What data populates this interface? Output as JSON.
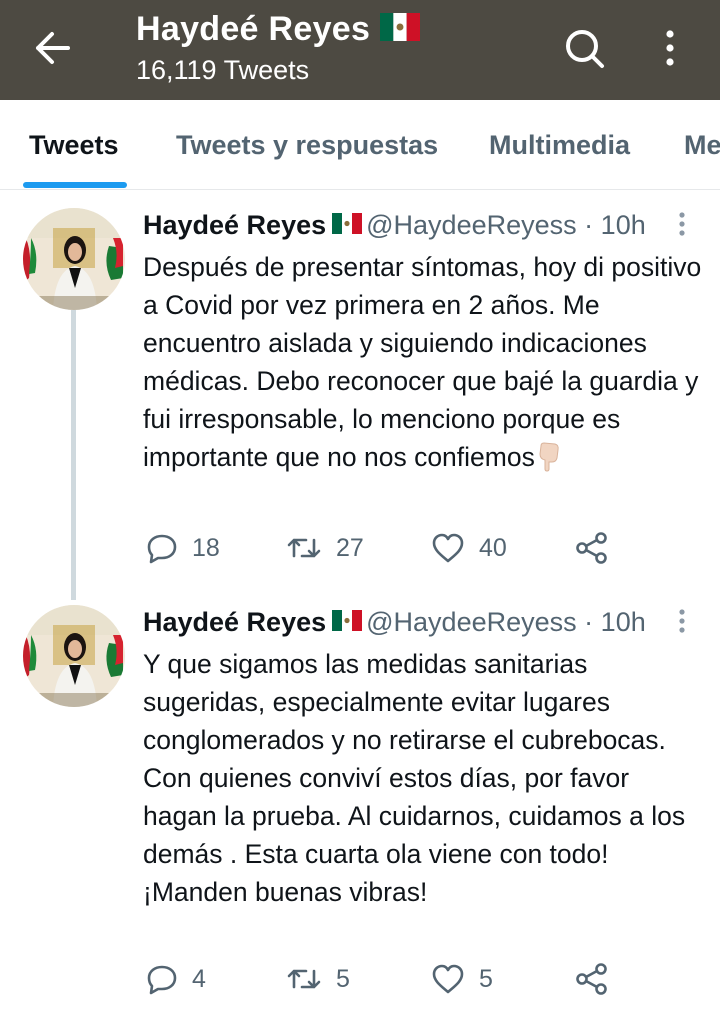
{
  "header": {
    "title": "Haydeé Reyes",
    "tweet_count": "16,119 Tweets"
  },
  "tabs": [
    {
      "label": "Tweets",
      "active": true
    },
    {
      "label": "Tweets y respuestas",
      "active": false
    },
    {
      "label": "Multimedia",
      "active": false
    },
    {
      "label": "Me",
      "active": false
    }
  ],
  "tweets": [
    {
      "name": "Haydeé Reyes",
      "handle": "@HaydeeReyess",
      "separator": "·",
      "time": "10h",
      "text": "Después de presentar síntomas, hoy di positivo a Covid por vez primera en 2 años. Me encuentro aislada y siguiendo indicaciones médicas.  Debo reconocer que bajé la guardia y fui irresponsable, lo menciono porque es importante que no nos confiemos",
      "trailing_emoji": "backhand-index-pointing-down",
      "replies": "18",
      "retweets": "27",
      "likes": "40"
    },
    {
      "name": "Haydeé Reyes",
      "handle": "@HaydeeReyess",
      "separator": "·",
      "time": "10h",
      "text": "Y que sigamos las medidas sanitarias sugeridas, especialmente evitar lugares conglomerados y no retirarse el cubrebocas.  Con quienes conviví estos días, por favor hagan la prueba. Al cuidarnos, cuidamos a los demás . Esta cuarta ola viene con todo!  ¡Manden buenas vibras!",
      "replies": "4",
      "retweets": "5",
      "likes": "5"
    }
  ],
  "icons": [
    "back-arrow-icon",
    "search-icon",
    "more-vertical-icon",
    "mexico-flag-icon",
    "caret-more-icon",
    "reply-icon",
    "retweet-icon",
    "like-icon",
    "share-icon"
  ],
  "colors": {
    "header_bg": "#4d4a42",
    "accent": "#1d9bf0",
    "secondary_text": "#536471",
    "thread_line": "#cfd9de"
  }
}
